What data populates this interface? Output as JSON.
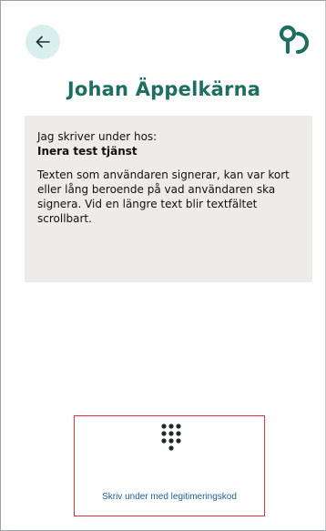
{
  "header": {
    "back_icon": "arrow-left-icon",
    "logo_icon": "eid-logo-icon"
  },
  "signer": {
    "name": "Johan Äppelkärna"
  },
  "document": {
    "intro": "Jag skriver under hos:",
    "service": "Inera test tjänst",
    "text": "Texten som användaren signerar, kan var kort eller lång beroende på vad användaren ska signera. Vid en längre text blir textfältet scrollbart."
  },
  "action": {
    "icon": "keypad-icon",
    "label": "Skriv under med legitimeringskod"
  },
  "colors": {
    "accent": "#1e6e61",
    "back_bg": "#d9efee",
    "card_bg": "#efebe8",
    "link": "#1a5f9a",
    "highlight_border": "#d9363c"
  }
}
